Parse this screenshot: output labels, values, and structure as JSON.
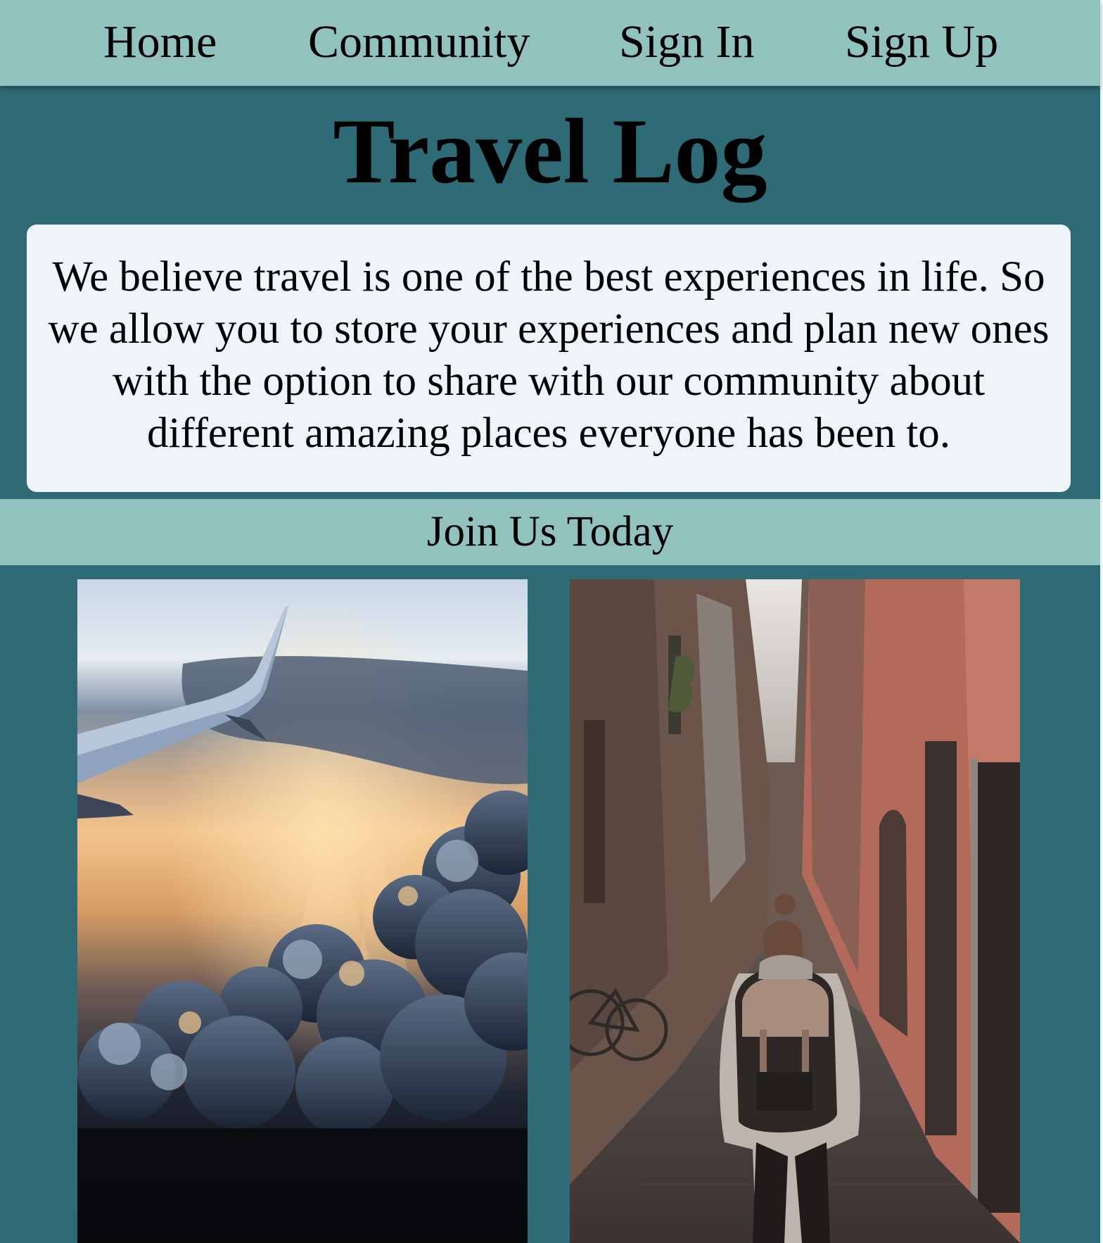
{
  "nav": {
    "home": "Home",
    "community": "Community",
    "sign_in": "Sign In",
    "sign_up": "Sign Up"
  },
  "title": "Travel Log",
  "intro": "We believe travel is one of the best experiences in life. So we allow you to store your experiences and plan new ones with the option to share with our community about different amazing places everyone has been to.",
  "join_label": "Join Us Today",
  "colors": {
    "page_background": "#2e6b77",
    "bar_background": "#92c2be",
    "card_background": "#eef4f8"
  }
}
